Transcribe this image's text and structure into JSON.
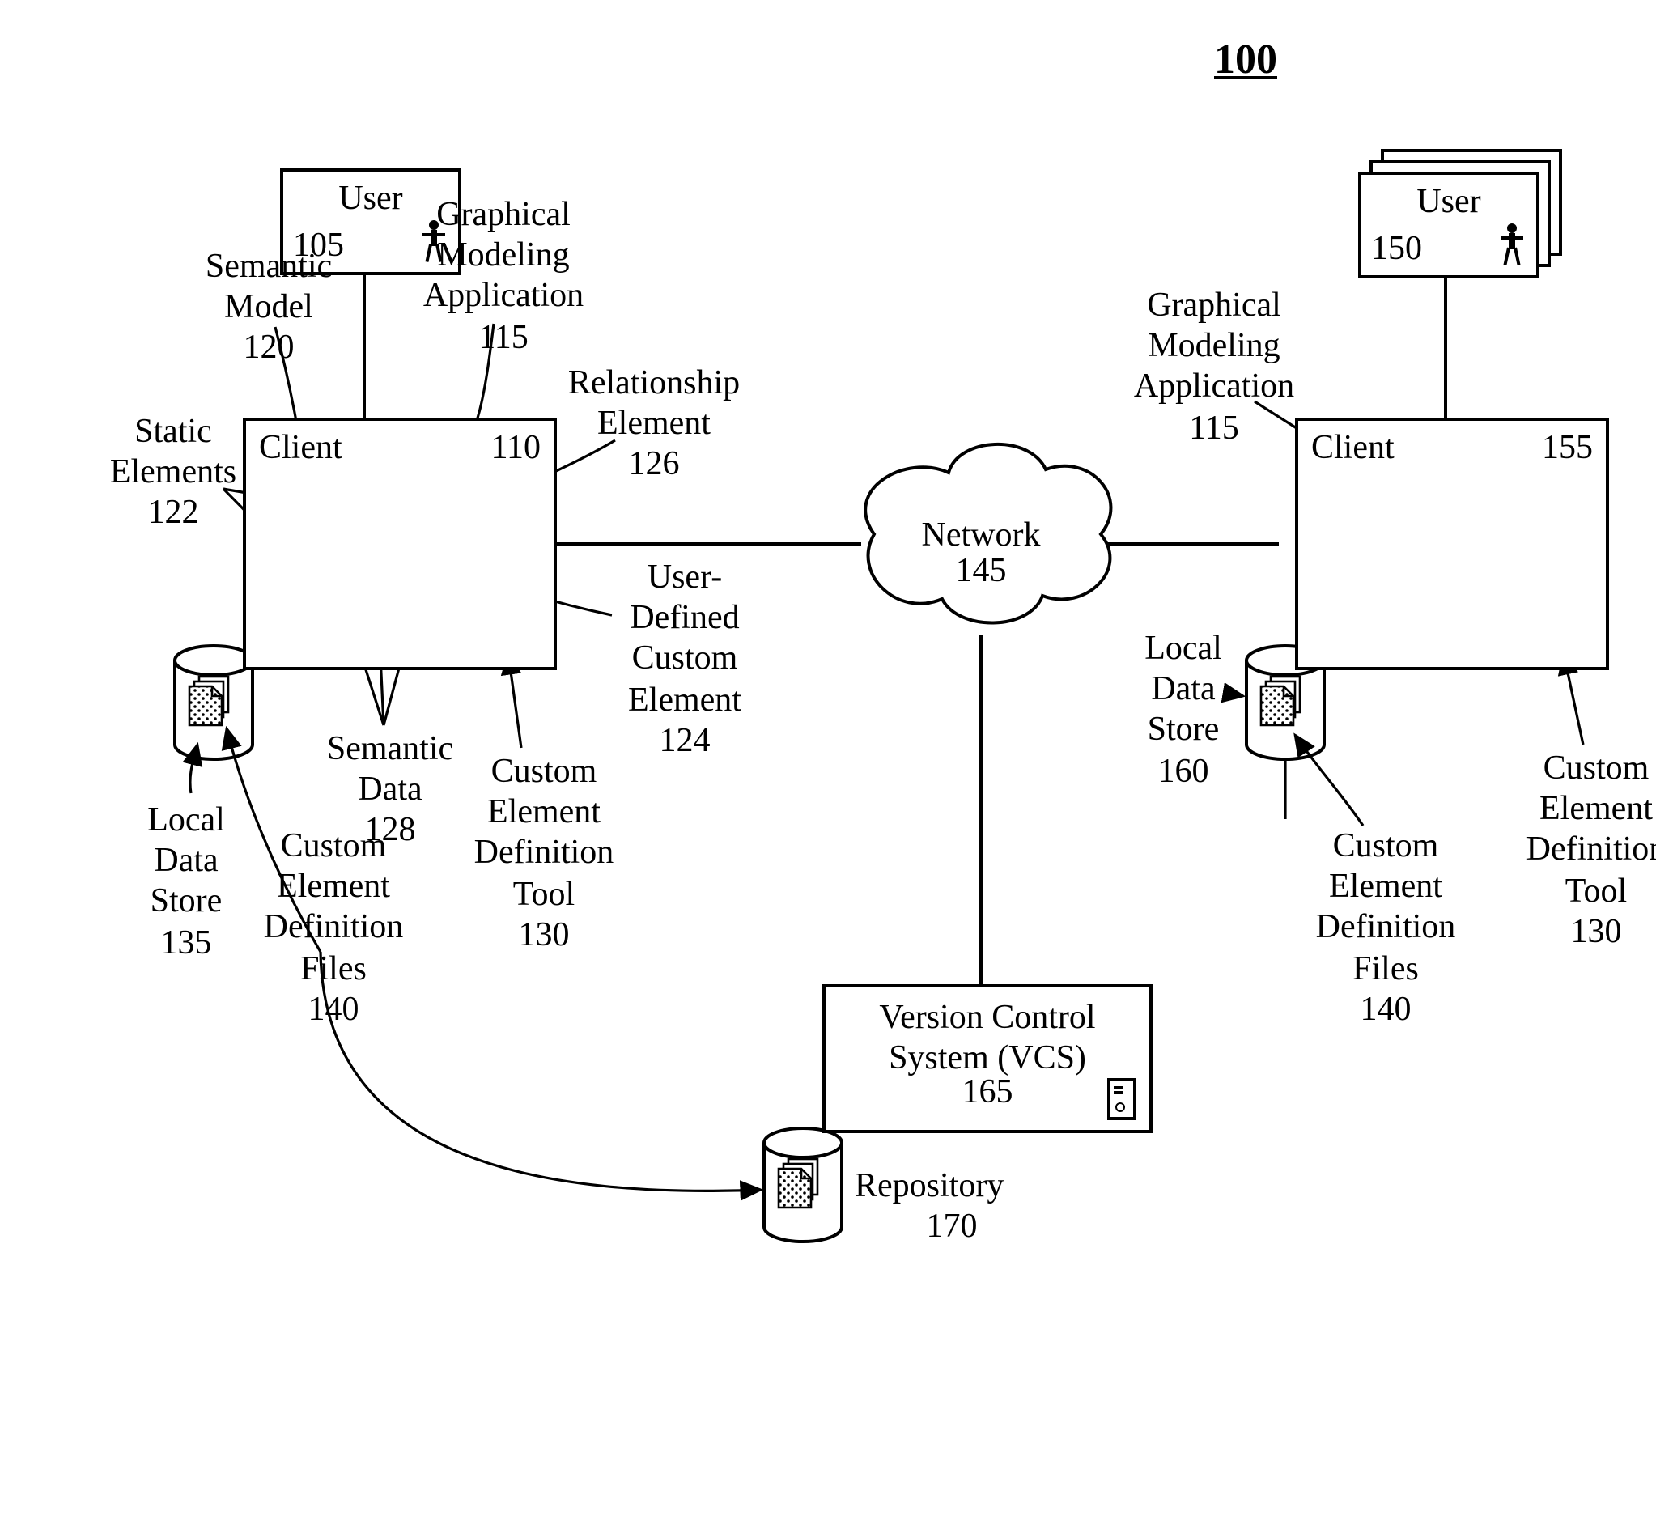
{
  "figure_number": "100",
  "user_left": {
    "title": "User",
    "ref": "105"
  },
  "user_right": {
    "title": "User",
    "ref": "150"
  },
  "client_left": {
    "title": "Client",
    "ref": "110"
  },
  "client_right": {
    "title": "Client",
    "ref": "155"
  },
  "app_left": {
    "title": "Graphical Modeling Application",
    "ref": "115"
  },
  "app_right": {
    "title": "Graphical Modeling Application",
    "ref": "115"
  },
  "semantic_model": {
    "title": "Semantic Model",
    "ref": "120"
  },
  "static_elements": {
    "title": "Static Elements",
    "ref": "122"
  },
  "user_defined": {
    "title": "User-Defined Custom Element",
    "ref": "124"
  },
  "relationship": {
    "title": "Relationship Element",
    "ref": "126"
  },
  "semantic_data": {
    "title": "Semantic Data",
    "ref": "128"
  },
  "tool_left": {
    "title": "Custom Element Definition Tool",
    "ref": "130"
  },
  "tool_right": {
    "title": "Custom Element Definition Tool",
    "ref": "130"
  },
  "store_left": {
    "title": "Local Data Store",
    "ref": "135"
  },
  "store_right": {
    "title": "Local Data Store",
    "ref": "160"
  },
  "files_left": {
    "title": "Custom Element Definition Files",
    "ref": "140"
  },
  "files_right": {
    "title": "Custom Element Definition Files",
    "ref": "140"
  },
  "network": {
    "title": "Network",
    "ref": "145"
  },
  "vcs": {
    "title": "Version Control System (VCS)",
    "ref": "165"
  },
  "repository": {
    "title": "Repository",
    "ref": "170"
  }
}
